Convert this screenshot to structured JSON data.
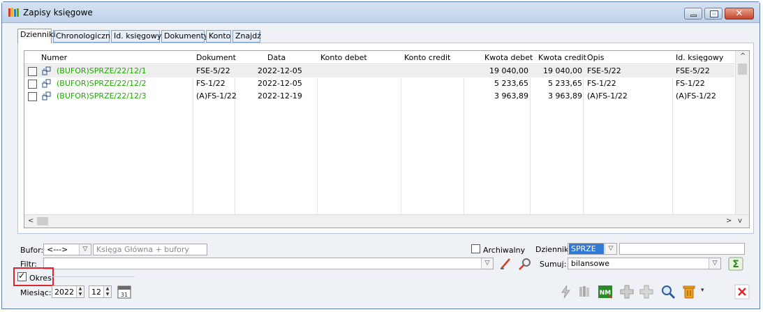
{
  "window": {
    "title": "Zapisy księgowe"
  },
  "tabs": [
    {
      "label": "Dzienniki"
    },
    {
      "label": "Chronologicznie"
    },
    {
      "label": "Id. księgowy"
    },
    {
      "label": "Dokumenty"
    },
    {
      "label": "Konto"
    },
    {
      "label": "Znajdź"
    }
  ],
  "table": {
    "columns": [
      "Numer",
      "Dokument",
      "Data",
      "Konto debet",
      "Konto credit",
      "Kwota debet",
      "Kwota credit",
      "Opis",
      "Id. księgowy"
    ],
    "rows": [
      {
        "numer": "(BUFOR)SPRZE/22/12/1",
        "dokument": "FSE-5/22",
        "data": "2022-12-05",
        "konto_debet": "",
        "konto_credit": "",
        "kwota_debet": "19 040,00",
        "kwota_credit": "19 040,00",
        "opis": "FSE-5/22",
        "id": "FSE-5/22"
      },
      {
        "numer": "(BUFOR)SPRZE/22/12/2",
        "dokument": "FS-1/22",
        "data": "2022-12-05",
        "konto_debet": "",
        "konto_credit": "",
        "kwota_debet": "5 233,65",
        "kwota_credit": "5 233,65",
        "opis": "FS-1/22",
        "id": "FS-1/22"
      },
      {
        "numer": "(BUFOR)SPRZE/22/12/3",
        "dokument": "(A)FS-1/22",
        "data": "2022-12-19",
        "konto_debet": "",
        "konto_credit": "",
        "kwota_debet": "3 963,89",
        "kwota_credit": "3 963,89",
        "opis": "(A)FS-1/22",
        "id": "(A)FS-1/22"
      }
    ]
  },
  "filters": {
    "bufor_label": "Bufor:",
    "bufor_value": "<--->",
    "bufor_desc": "Księga Główna + bufory",
    "archiwalny_label": "Archiwalny",
    "dziennik_label": "Dziennik:",
    "dziennik_value": "SPRZE",
    "filtr_label": "Filtr:",
    "sumuj_label": "Sumuj:",
    "sumuj_value": "bilansowe",
    "okres_label": "Okres",
    "miesiac_label": "Miesiąc:",
    "year": "2022",
    "month": "12"
  },
  "colors": {
    "accent_red": "#e1242c",
    "green_text": "#1faa00",
    "selection": "#2f79d8"
  }
}
